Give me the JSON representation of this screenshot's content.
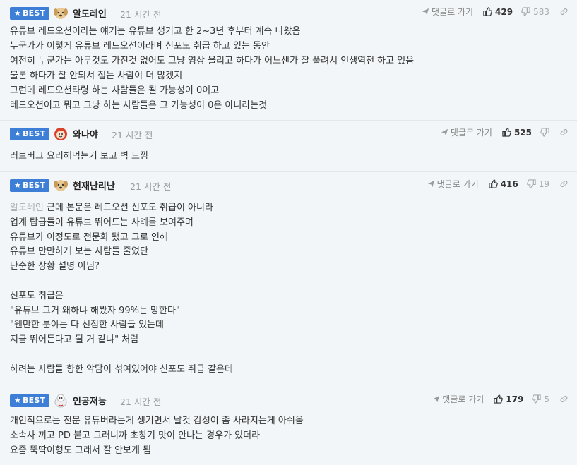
{
  "badge_label": "BEST",
  "reply_label": "댓글로 가기",
  "comments": [
    {
      "nick": "알도레인",
      "time": "21 시간 전",
      "likes": "429",
      "dislikes": "583",
      "mention": "",
      "lines": [
        "유튜브 레드오션이라는 얘기는 유튜브 생기고 한 2~3년 후부터 계속 나왔음",
        "누군가가 이렇게 유튜브 레드오션이라며 신포도 취급 하고 있는 동안",
        "여전히 누군가는 아무것도 가진것 없어도 그냥 영상 올리고 하다가 어느샌가 잘 풀려서 인생역전 하고 있음",
        "물론 하다가 잘 안되서 접는 사람이 더 많겠지",
        "그런데 레드오션타령 하는 사람들은 될 가능성이 0이고",
        "레드오션이고 뭐고 그냥 하는 사람들은 그 가능성이 0은 아니라는것"
      ]
    },
    {
      "nick": "와나야",
      "time": "21 시간 전",
      "likes": "525",
      "dislikes": "",
      "mention": "",
      "lines": [
        "러브버그 요리해먹는거 보고 벽 느낌"
      ]
    },
    {
      "nick": "현재난리난",
      "time": "21 시간 전",
      "likes": "416",
      "dislikes": "19",
      "mention": "알도레인",
      "first_line": " 근데 본문은 레드오션 신포도 취급이 아니라",
      "lines": [
        "업계 탑급들이 유튜브 뛰어드는 사례를 보여주며",
        "유튜브가 이정도로 전문화 됐고 그로 인해",
        "유튜브 만만하게 보는 사람들 줄었단",
        "단순한 상황 설명 아님?",
        "",
        "신포도 취급은",
        "\"유튜브 그거 왜하냐 해봤자 99%는 망한다\"",
        "\"웬만한 분야는 다 선점한 사람들 있는데",
        "지금 뛰어든다고 될 거 같냐\" 처럼",
        "",
        "하려는 사람들 향한 악담이 섞여있어야 신포도 취급 같은데"
      ]
    },
    {
      "nick": "인공저능",
      "time": "21 시간 전",
      "likes": "179",
      "dislikes": "5",
      "mention": "",
      "lines": [
        "개인적으로는 전문 유튜버라는게 생기면서 날것 감성이 좀 사라지는게 아쉬움",
        "소속사 끼고 PD 붙고 그러니까 초창기 맛이 안나는 경우가 있더라",
        "요즘 뚝딱이형도 그래서 잘 안보게 됨"
      ]
    }
  ],
  "colors": {
    "badge": "#3d7fd6",
    "row_bg": "#f2f6f9",
    "mention": "#aaaaaa"
  },
  "icons": {
    "reply": "paper-plane-icon",
    "like": "thumbs-up-icon",
    "dislike": "thumbs-down-icon",
    "link": "link-icon"
  }
}
